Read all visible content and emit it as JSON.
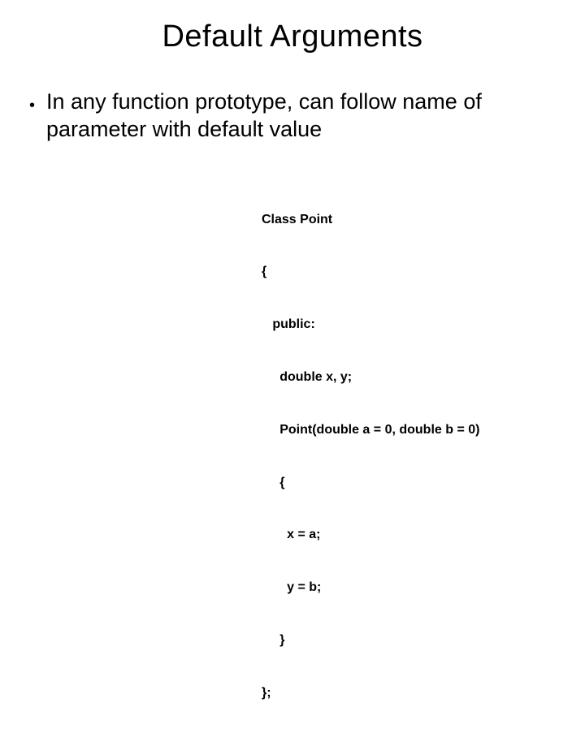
{
  "title": "Default Arguments",
  "bullet": {
    "marker": "•",
    "text": "In any function prototype, can follow name of parameter with default value"
  },
  "code": {
    "l1": "Class Point",
    "l2": "{",
    "l3": "   public:",
    "l4": "     double x, y;",
    "l5": "     Point(double a = 0, double b = 0)",
    "l6": "     {",
    "l7": "       x = a;",
    "l8": "       y = b;",
    "l9": "     }",
    "l10": "};"
  }
}
